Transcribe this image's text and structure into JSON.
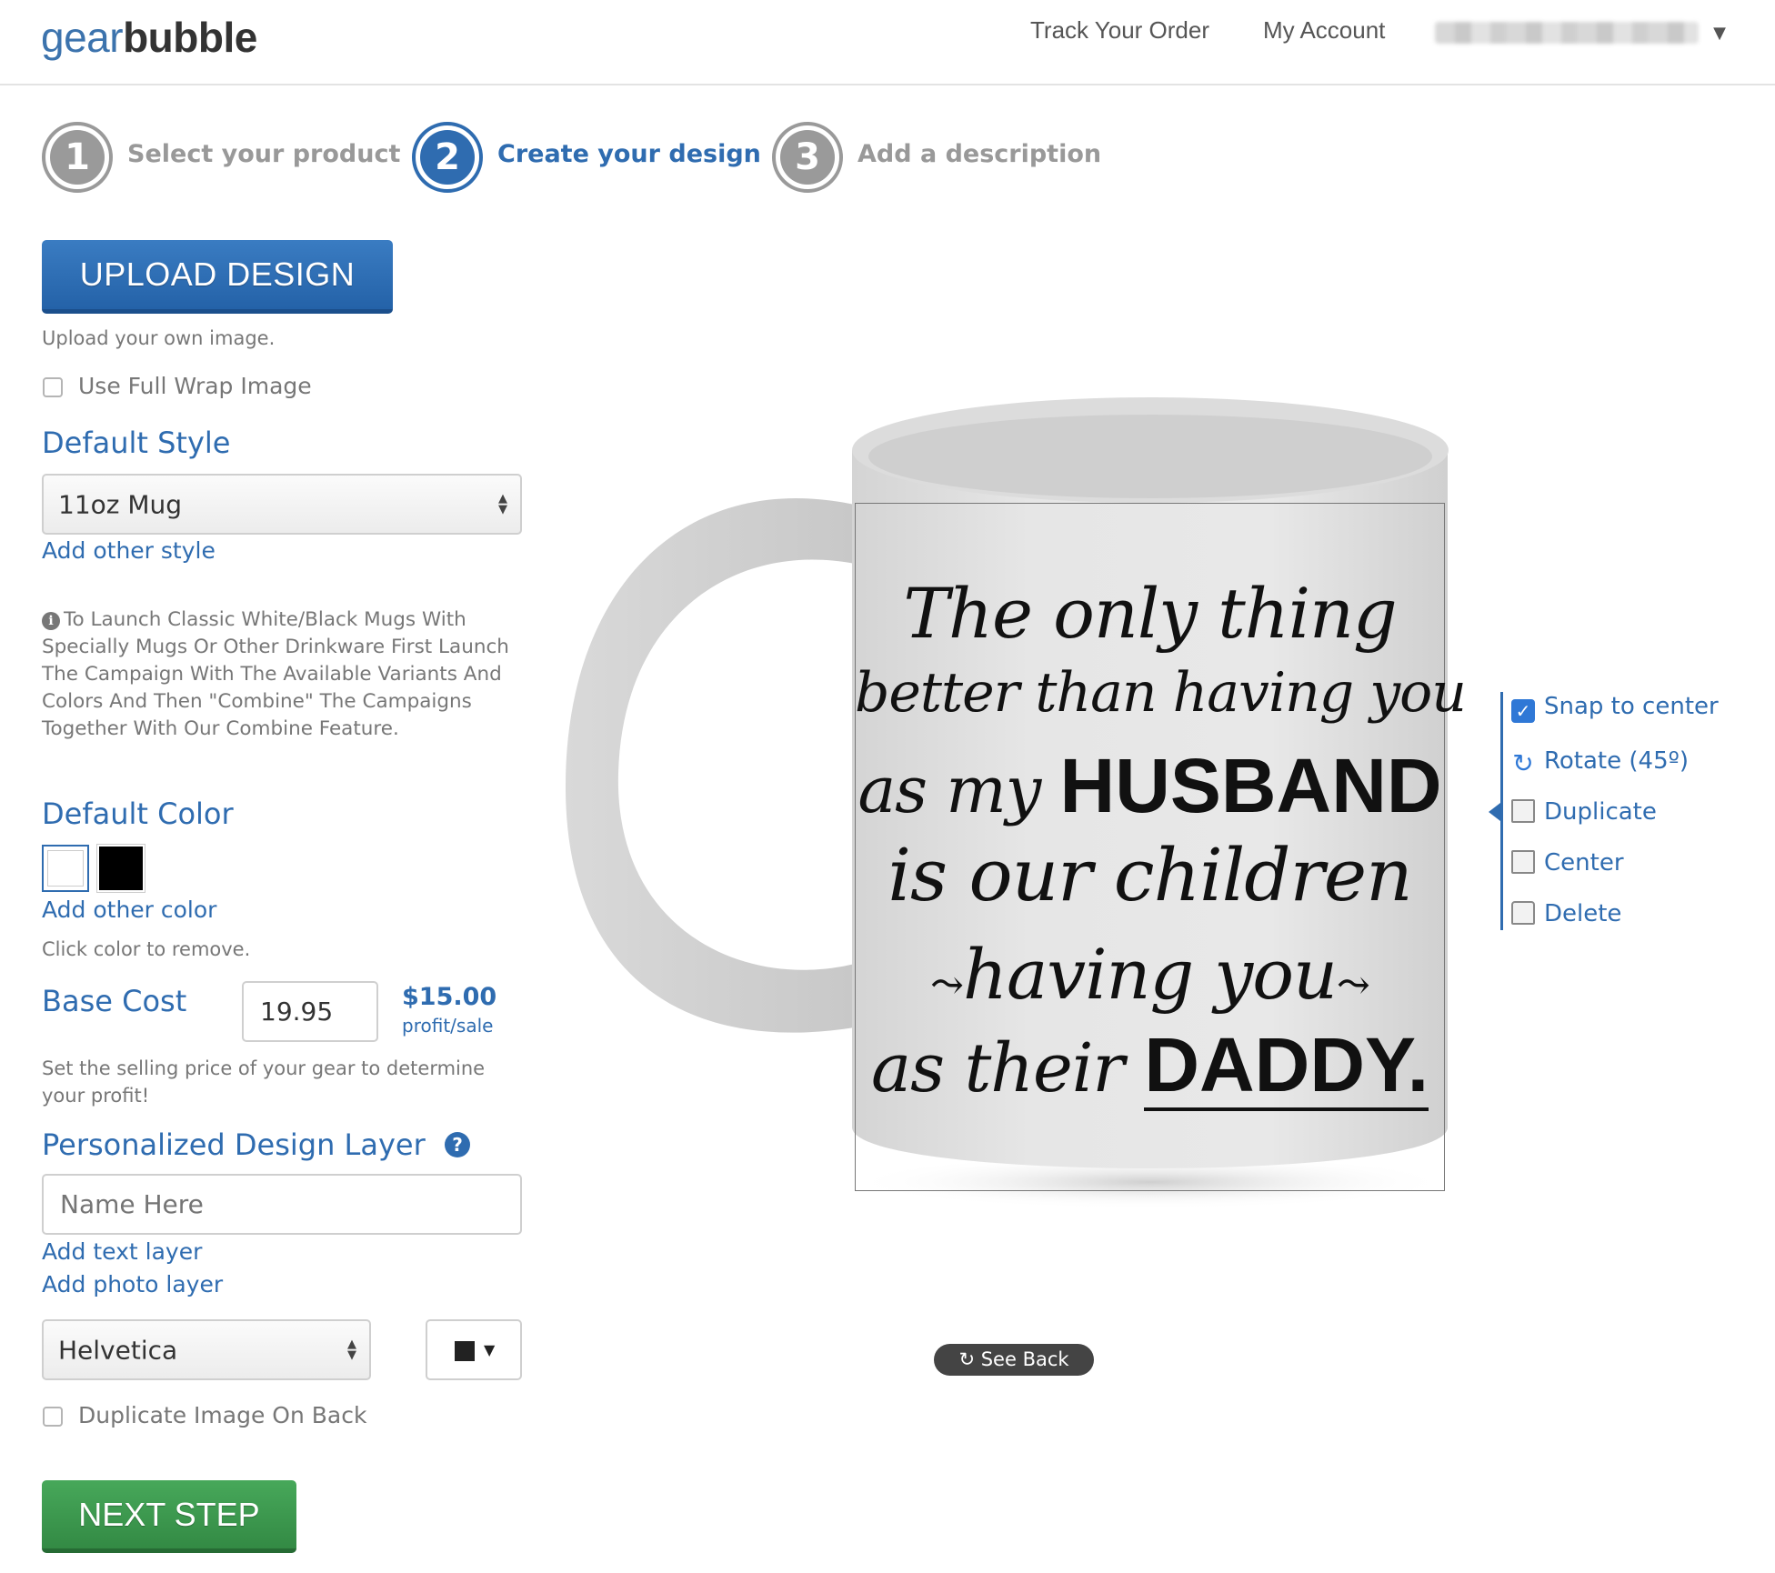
{
  "header": {
    "logo_part1": "gear",
    "logo_part2": "bubble",
    "nav": {
      "track": "Track Your Order",
      "account": "My Account"
    }
  },
  "steps": [
    {
      "number": "1",
      "label": "Select your product",
      "active": false
    },
    {
      "number": "2",
      "label": "Create your design",
      "active": true
    },
    {
      "number": "3",
      "label": "Add a description",
      "active": false
    }
  ],
  "upload": {
    "button": "UPLOAD DESIGN",
    "hint": "Upload your own image."
  },
  "full_wrap": {
    "label": "Use Full Wrap Image",
    "checked": false
  },
  "default_style": {
    "title": "Default Style",
    "selected": "11oz Mug",
    "add_link": "Add other style",
    "note": "To Launch Classic White/Black Mugs With Specially Mugs Or Other Drinkware First Launch The Campaign With The Available Variants And Colors And Then \"Combine\" The Campaigns Together With Our Combine Feature."
  },
  "default_color": {
    "title": "Default Color",
    "swatches": [
      "#ffffff",
      "#000000"
    ],
    "add_link": "Add other color",
    "hint": "Click color to remove."
  },
  "base_cost": {
    "title": "Base Cost",
    "value": "19.95",
    "profit": "$15.00",
    "profit_label": "profit/sale",
    "hint": "Set the selling price of your gear to determine your profit!"
  },
  "personalized": {
    "title": "Personalized Design Layer",
    "help_icon": "?",
    "placeholder": "Name Here",
    "add_text": "Add text layer",
    "add_photo": "Add photo layer",
    "font": "Helvetica",
    "text_color": "#222222"
  },
  "duplicate_back": {
    "label": "Duplicate Image On Back",
    "checked": false
  },
  "next_button": "NEXT STEP",
  "mug": {
    "color": "#ffffff",
    "quote": {
      "line1": "The only thing",
      "line2": "better than having you",
      "line3a": "as my ",
      "line3b": "HUSBAND",
      "line4": "is our children",
      "line5": "having you",
      "line6a": "as their ",
      "line6b": "DADDY."
    }
  },
  "see_back": "See Back",
  "tools": {
    "snap": "Snap to center",
    "rotate": "Rotate (45º)",
    "duplicate": "Duplicate",
    "center": "Center",
    "delete": "Delete"
  },
  "colors": {
    "brand_blue": "#2f6cb0",
    "upload_blue": "#2462a8",
    "next_green": "#338a44",
    "muted_gray": "#999999"
  }
}
